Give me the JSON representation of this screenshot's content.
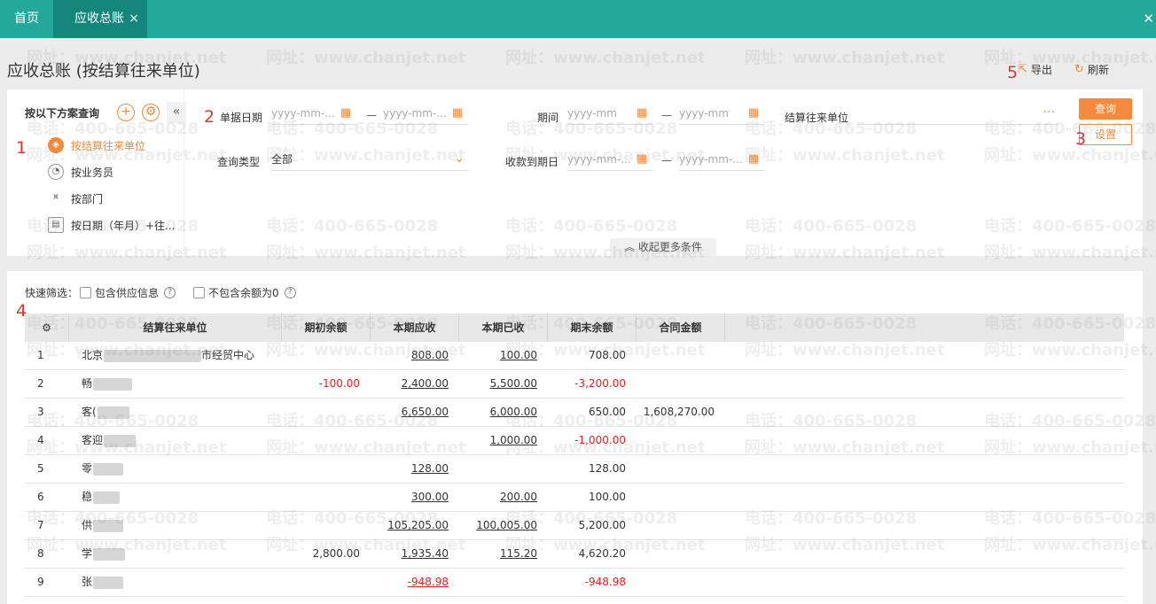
{
  "tabs": {
    "home": "首页",
    "active": "应收总账",
    "close_glyph": "×",
    "window_close_glyph": "✕"
  },
  "watermark": {
    "phone": "电话：400-665-0028",
    "site": "网址：www.chanjet.net"
  },
  "page": {
    "title": "应收总账 (按结算往来单位)",
    "export_label": "导出",
    "refresh_label": "刷新"
  },
  "scheme": {
    "title": "按以下方案查询",
    "items": [
      {
        "label": "按结算往来单位",
        "icon": "cube-icon",
        "active": true
      },
      {
        "label": "按业务员",
        "icon": "clock-icon",
        "active": false
      },
      {
        "label": "按部门",
        "icon": "chart-icon",
        "active": false
      },
      {
        "label": "按日期（年月）+往...",
        "icon": "calendar-icon",
        "active": false
      }
    ]
  },
  "filters": {
    "doc_date_label": "单据日期",
    "doc_date_from_placeholder": "yyyy-mm-...",
    "doc_date_to_placeholder": "yyyy-mm-...",
    "period_label": "期间",
    "period_from_placeholder": "yyyy-mm",
    "period_to_placeholder": "yyyy-mm",
    "partner_label": "结算往来单位",
    "partner_more": "···",
    "query_type_label": "查询类型",
    "query_type_value": "全部",
    "due_date_label": "收款到期日",
    "due_from_placeholder": "yyyy-mm-...",
    "due_to_placeholder": "yyyy-mm-...",
    "dash": "—",
    "query_button": "查询",
    "settings_button": "设置",
    "more_conditions": "收起更多条件"
  },
  "quick_filter": {
    "label": "快速筛选：",
    "opt1": "包含供应信息",
    "opt2": "不包含余额为0"
  },
  "table": {
    "headers": [
      "结算往来单位",
      "期初余额",
      "本期应收",
      "本期已收",
      "期末余额",
      "合同金额"
    ],
    "rows": [
      {
        "no": "1",
        "partner_visible": "北京",
        "partner_tail": "市经贸中心",
        "begin": "",
        "receivable": "808.00",
        "received": "100.00",
        "end": "708.00",
        "contract": ""
      },
      {
        "no": "2",
        "partner_visible": "畅",
        "partner_tail": "",
        "begin": "-100.00",
        "receivable": "2,400.00",
        "received": "5,500.00",
        "end": "-3,200.00",
        "contract": ""
      },
      {
        "no": "3",
        "partner_visible": "客(",
        "partner_tail": "",
        "begin": "",
        "receivable": "6,650.00",
        "received": "6,000.00",
        "end": "650.00",
        "contract": "1,608,270.00"
      },
      {
        "no": "4",
        "partner_visible": "客迎",
        "partner_tail": "",
        "begin": "",
        "receivable": "",
        "received": "1,000.00",
        "end": "-1,000.00",
        "contract": ""
      },
      {
        "no": "5",
        "partner_visible": "零",
        "partner_tail": "",
        "begin": "",
        "receivable": "128.00",
        "received": "",
        "end": "128.00",
        "contract": ""
      },
      {
        "no": "6",
        "partner_visible": "稳",
        "partner_tail": "",
        "begin": "",
        "receivable": "300.00",
        "received": "200.00",
        "end": "100.00",
        "contract": ""
      },
      {
        "no": "7",
        "partner_visible": "供",
        "partner_tail": "",
        "begin": "",
        "receivable": "105,205.00",
        "received": "100,005.00",
        "end": "5,200.00",
        "contract": ""
      },
      {
        "no": "8",
        "partner_visible": "学",
        "partner_tail": "",
        "begin": "2,800.00",
        "receivable": "1,935.40",
        "received": "115.20",
        "end": "4,620.20",
        "contract": ""
      },
      {
        "no": "9",
        "partner_visible": "张",
        "partner_tail": "",
        "begin": "",
        "receivable": "-948.98",
        "received": "",
        "end": "-948.98",
        "contract": ""
      }
    ]
  },
  "annotations": [
    "1",
    "2",
    "3",
    "4",
    "5"
  ],
  "colors": {
    "topbar": "#23a89a",
    "accent": "#f58a3c",
    "negative": "#e02020"
  }
}
